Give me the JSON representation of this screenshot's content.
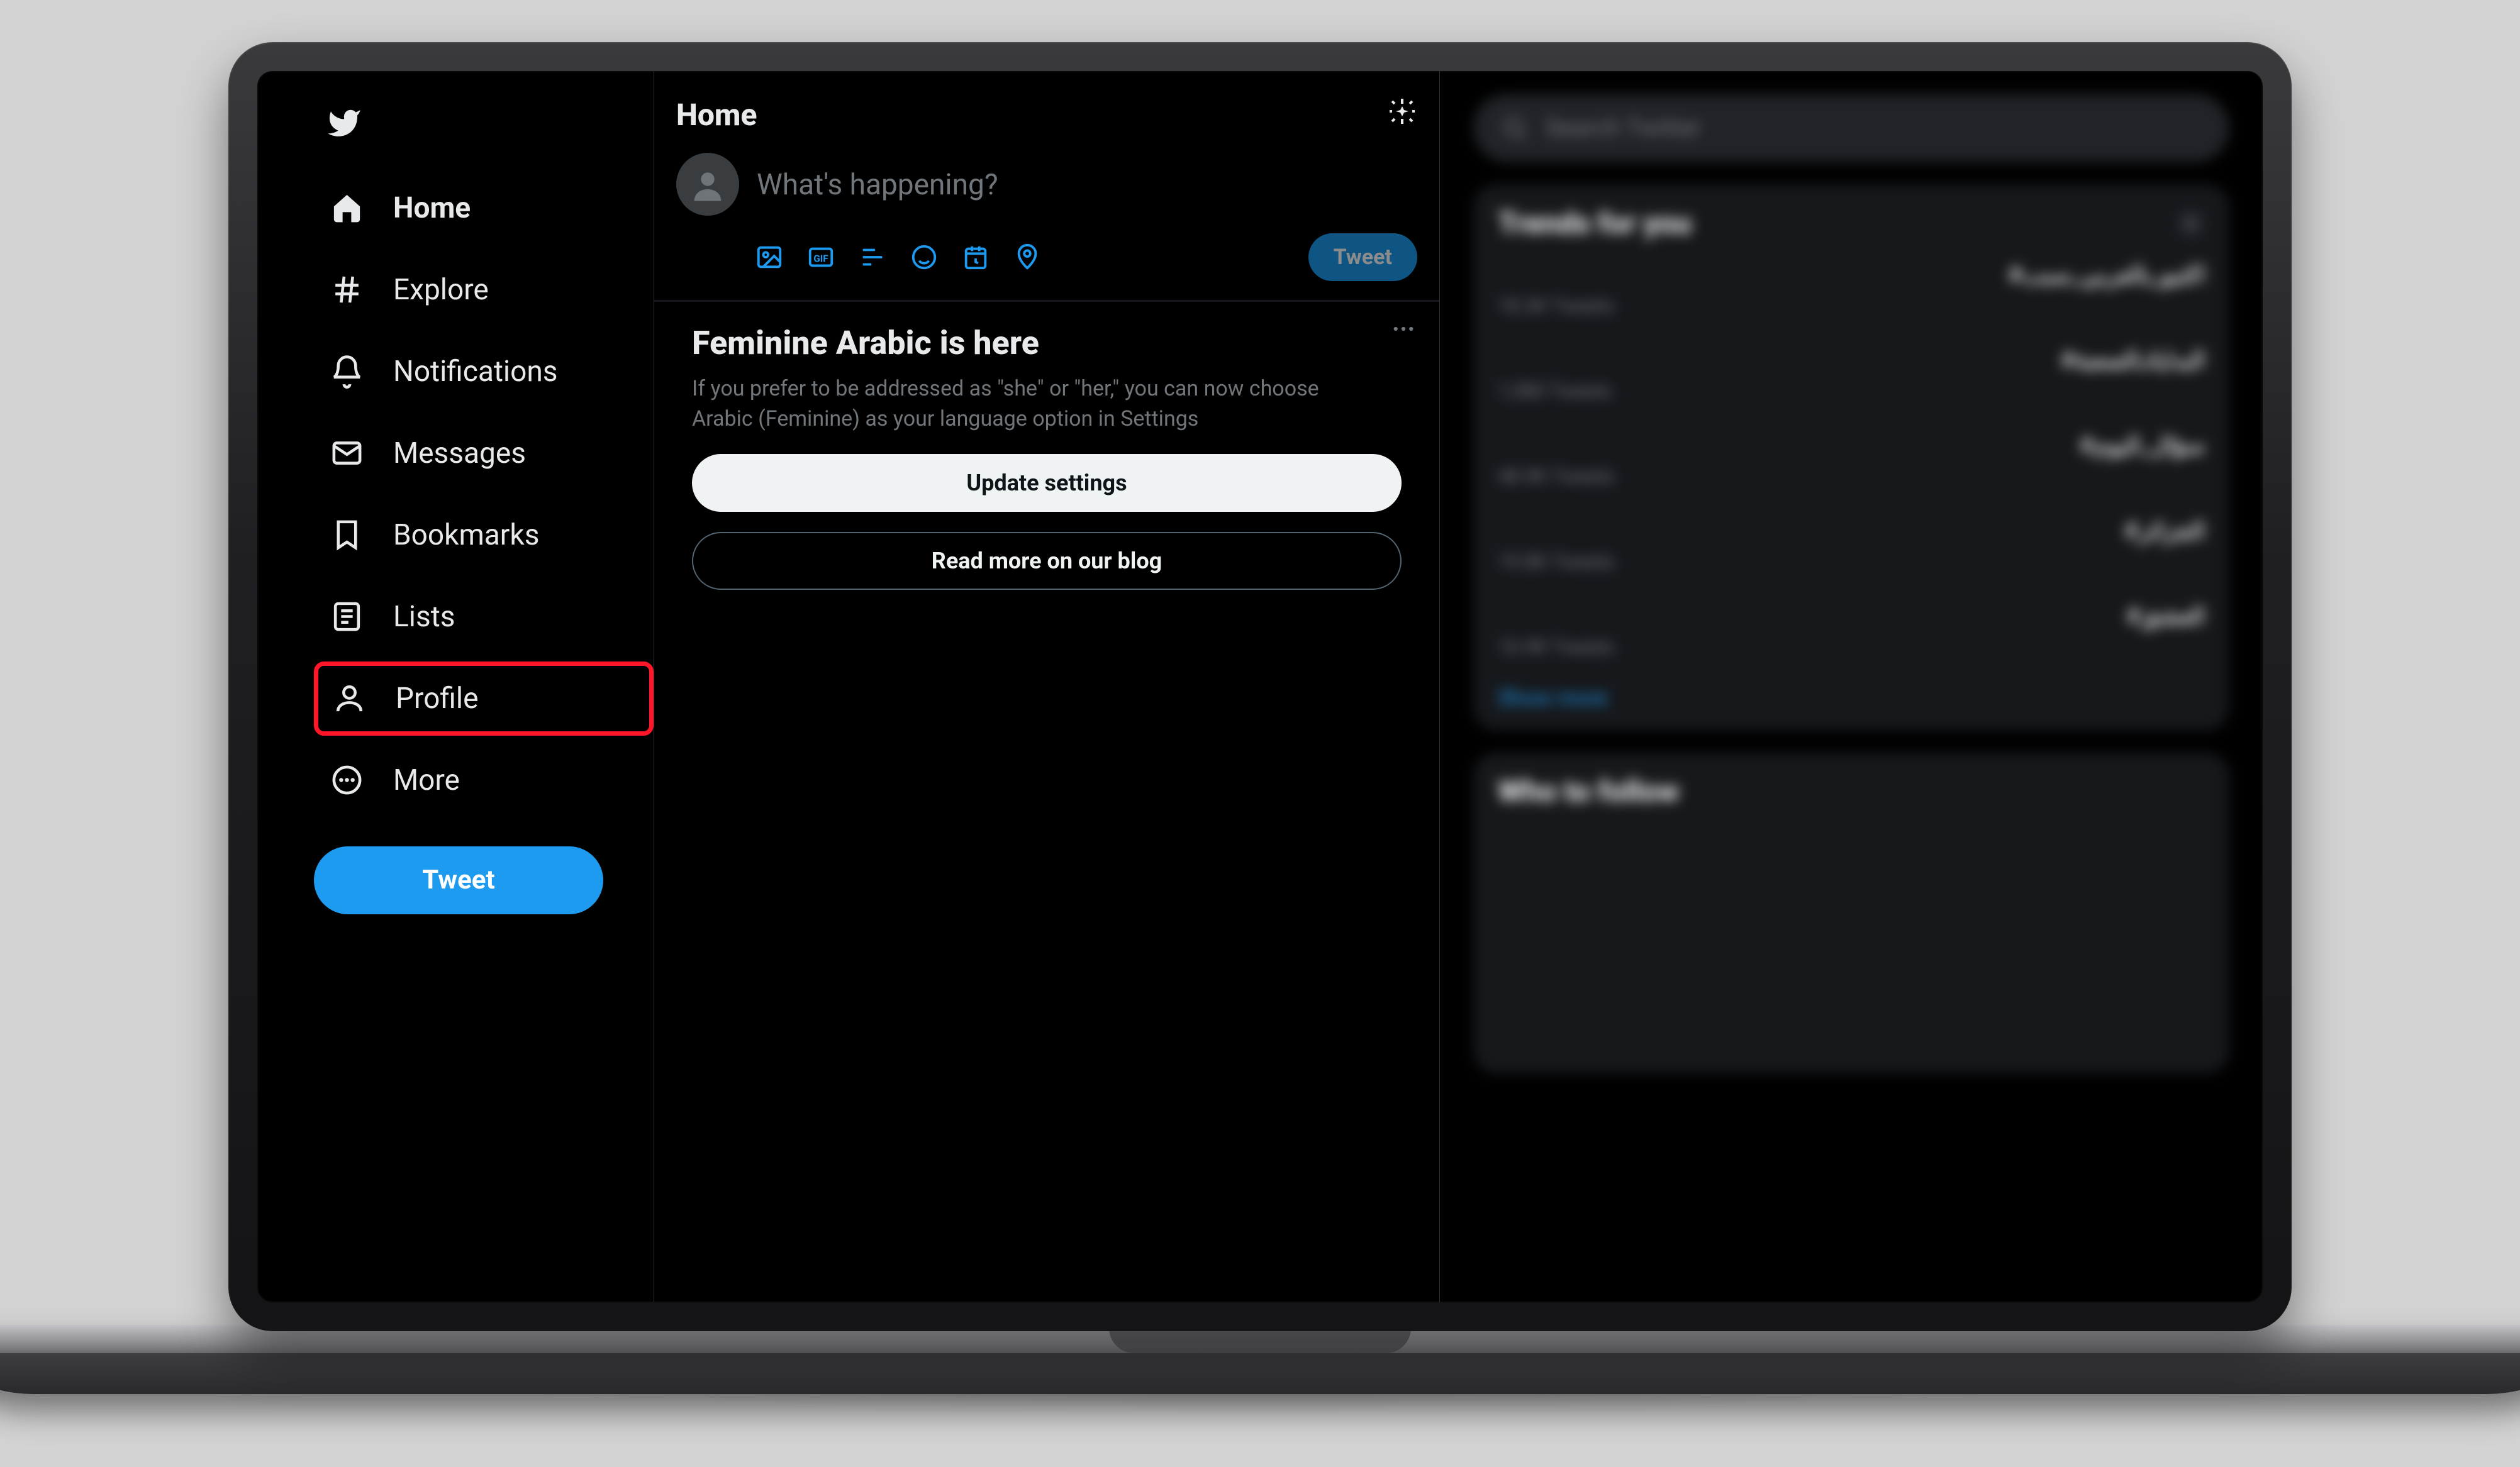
{
  "colors": {
    "accent": "#1d9bf0",
    "highlight_border": "#ff1628"
  },
  "sidebar": {
    "items": [
      {
        "id": "home",
        "label": "Home",
        "icon": "home-icon",
        "active": true
      },
      {
        "id": "explore",
        "label": "Explore",
        "icon": "hash-icon",
        "active": false
      },
      {
        "id": "notifications",
        "label": "Notifications",
        "icon": "bell-icon",
        "active": false
      },
      {
        "id": "messages",
        "label": "Messages",
        "icon": "envelope-icon",
        "active": false
      },
      {
        "id": "bookmarks",
        "label": "Bookmarks",
        "icon": "bookmark-icon",
        "active": false
      },
      {
        "id": "lists",
        "label": "Lists",
        "icon": "list-icon",
        "active": false
      },
      {
        "id": "profile",
        "label": "Profile",
        "icon": "person-icon",
        "active": false,
        "highlighted": true
      },
      {
        "id": "more",
        "label": "More",
        "icon": "ellipsis-circle-icon",
        "active": false
      }
    ],
    "tweet_button": "Tweet"
  },
  "header": {
    "title": "Home"
  },
  "compose": {
    "placeholder": "What's happening?",
    "tweet_label": "Tweet",
    "icons": [
      "image-icon",
      "gif-icon",
      "poll-icon",
      "emoji-icon",
      "schedule-icon",
      "location-icon"
    ]
  },
  "promo": {
    "title": "Feminine Arabic is here",
    "body": "If you prefer to be addressed as \"she\" or \"her,\" you can now choose Arabic (Feminine) as your language option in Settings",
    "primary_label": "Update settings",
    "secondary_label": "Read more on our blog"
  },
  "right": {
    "search_placeholder": "Search Twitter",
    "trends_title": "Trends for you",
    "trends": [
      {
        "main": "#اكتبو_بالعربي_سبب",
        "sub": "18.3K Tweets"
      },
      {
        "main": "#البداياتـالصعبة",
        "sub": "1,580 Tweets"
      },
      {
        "main": "#سؤال_اليوم",
        "sub": "48.9K Tweets"
      },
      {
        "main": "#الجزائر",
        "sub": "19.8K Tweets"
      },
      {
        "main": "#العشق",
        "sub": "16.9K Tweets"
      }
    ],
    "show_more": "Show more",
    "wtf_title": "Who to follow"
  }
}
